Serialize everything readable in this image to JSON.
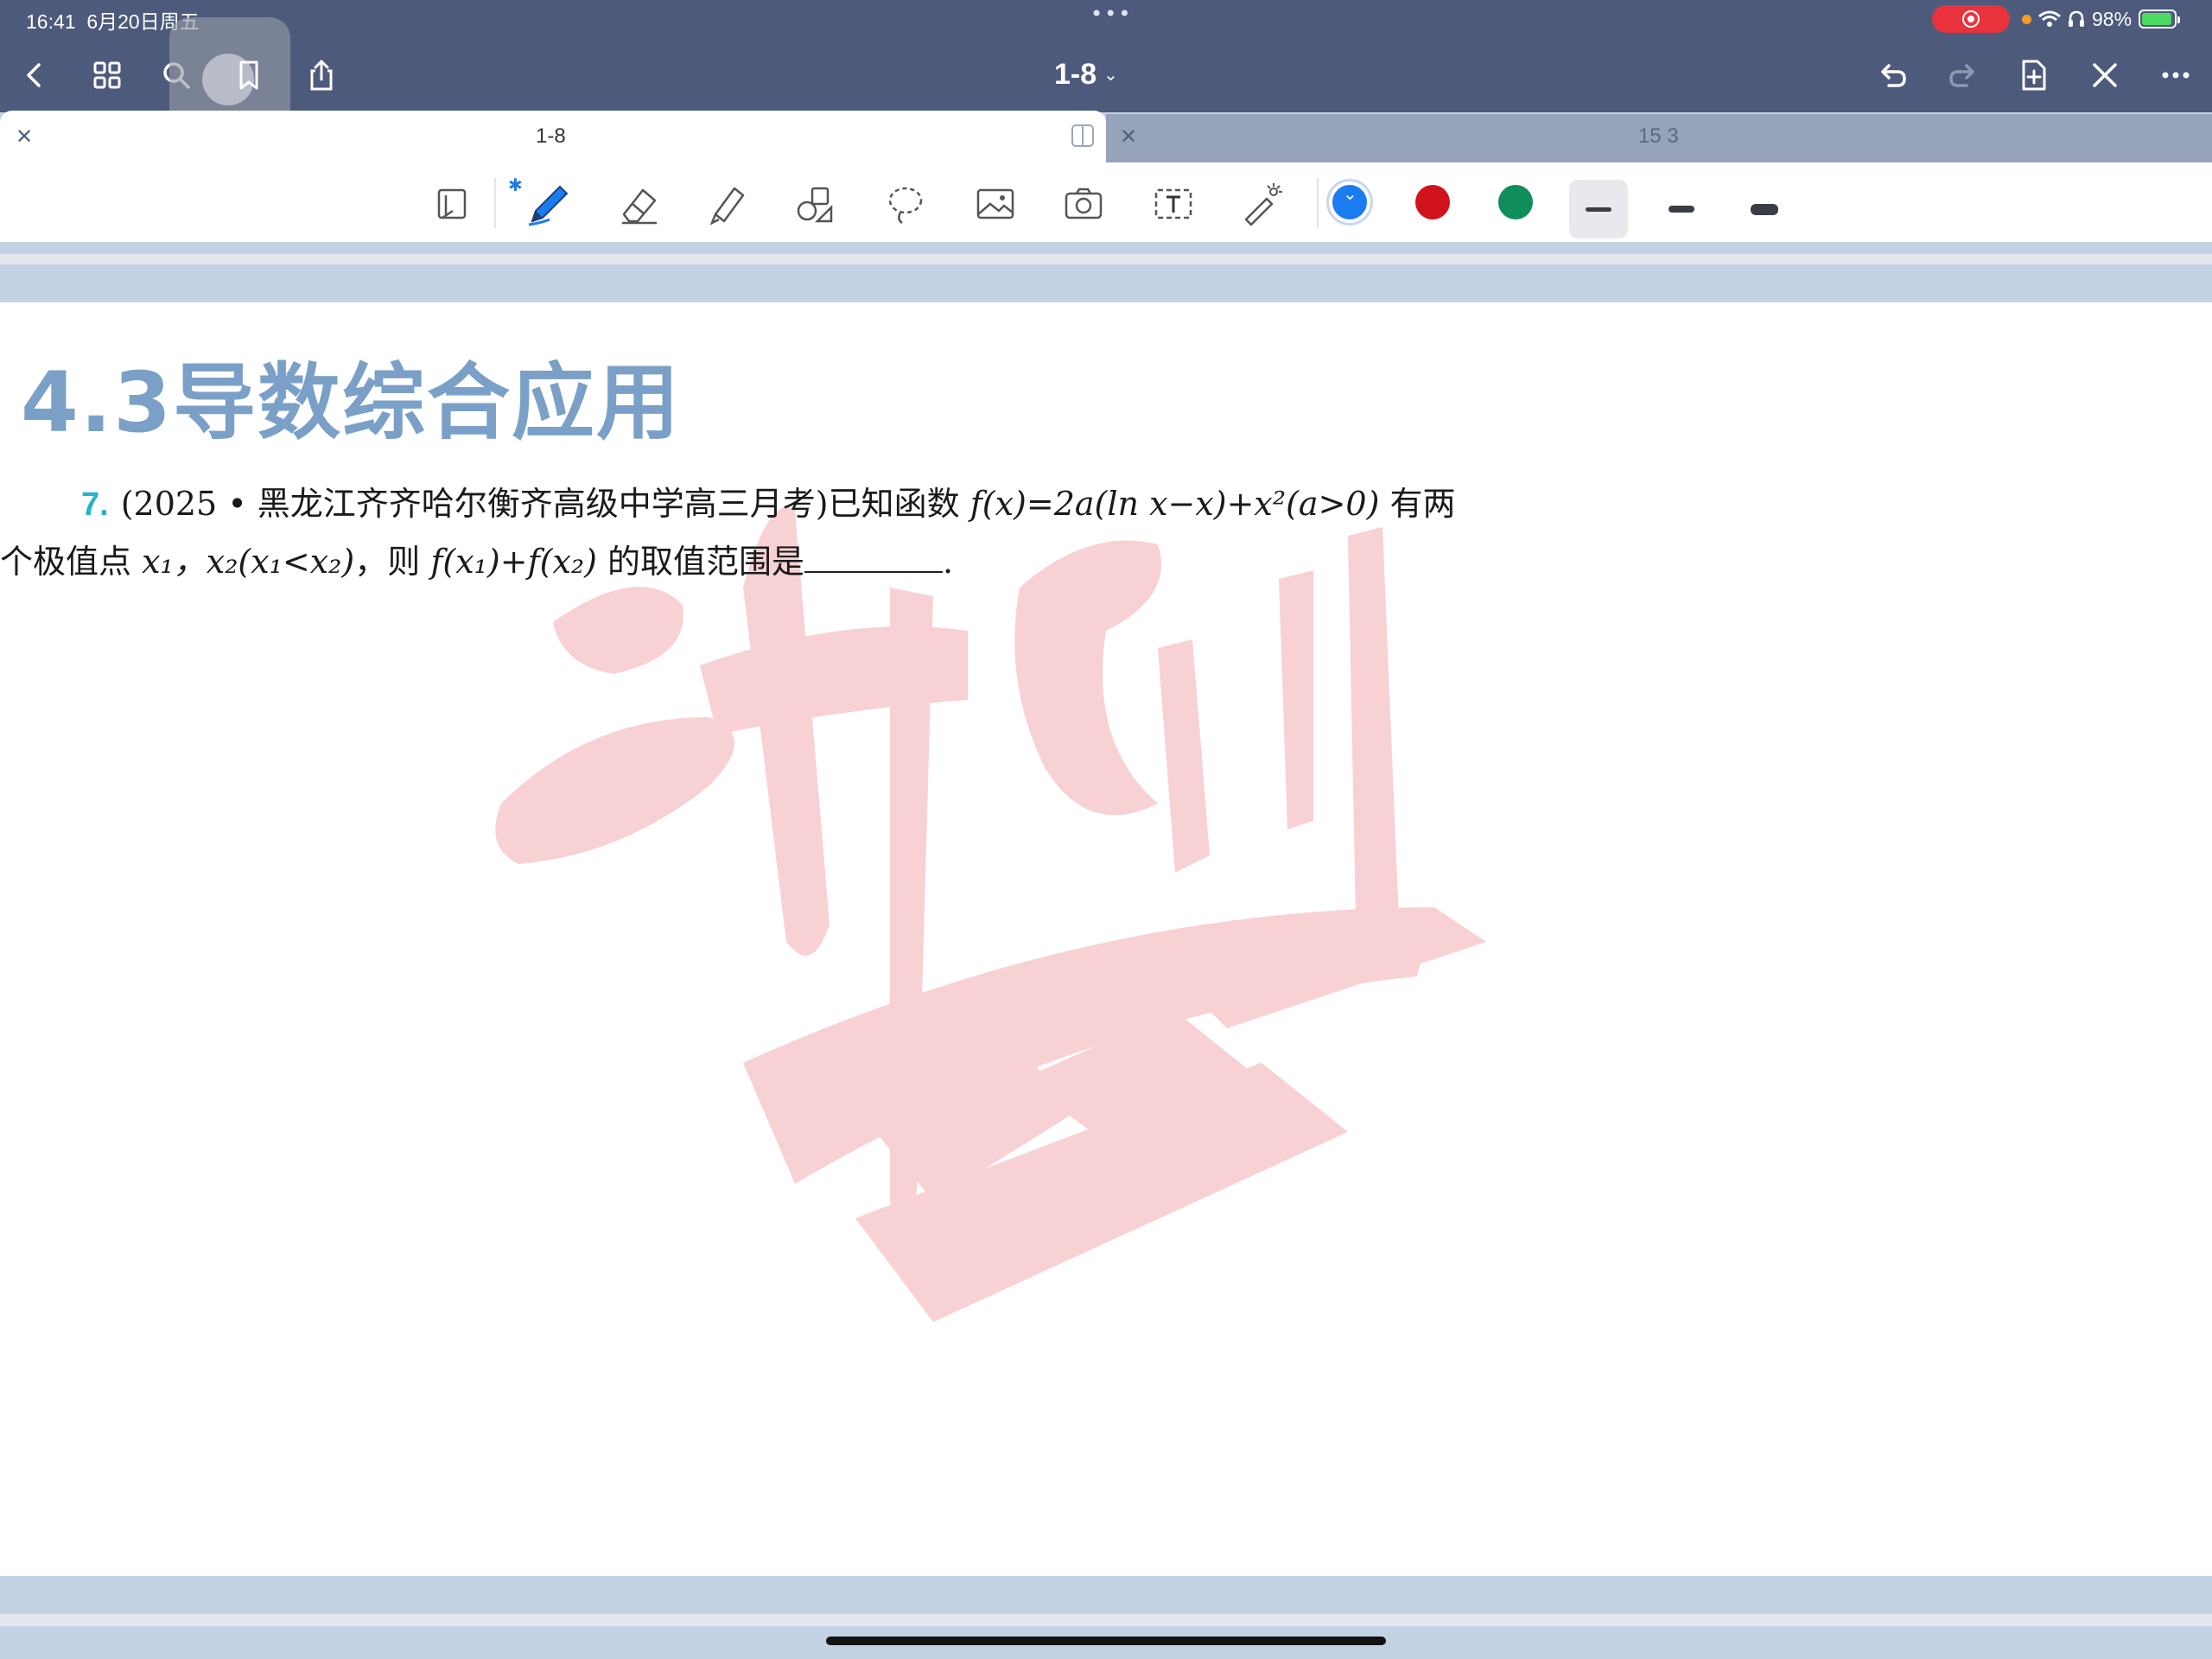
{
  "status": {
    "time": "16:41",
    "date": "6月20日周五",
    "dots": "•••",
    "battery": "98%",
    "battery_level": 0.98
  },
  "nav": {
    "doc_title": "1-8",
    "chevron": "⌄"
  },
  "tabs": [
    {
      "label": "1-8",
      "active": true
    },
    {
      "label": "15 3",
      "active": false
    }
  ],
  "toolbar": {
    "bluetooth": "✱",
    "colors": [
      "#1a7cf0",
      "#d0121b",
      "#0f8d5a"
    ],
    "selected_color": "#1a7cf0",
    "widths": [
      "thin",
      "medium",
      "thick"
    ],
    "selected_width": "thin"
  },
  "page": {
    "section_title": "4.3导数综合应用",
    "question": {
      "number": "7.",
      "line1_source": "(2025 • 黑龙江齐齐哈尔衡齐高级中学高三月考)已知函数 ",
      "line1_math": "f(x)=2a(ln x−x)+x²(a>0)",
      "line1_tail": " 有两",
      "line2_text": "个极值点 ",
      "line2_math1": "x₁，x₂(x₁<x₂)",
      "line2_mid": "，则 ",
      "line2_math2": "f(x₁)+f(x₂)",
      "line2_tail": " 的取值范围是",
      "end_mark": "."
    },
    "watermark_color": "#f6c2c6"
  }
}
